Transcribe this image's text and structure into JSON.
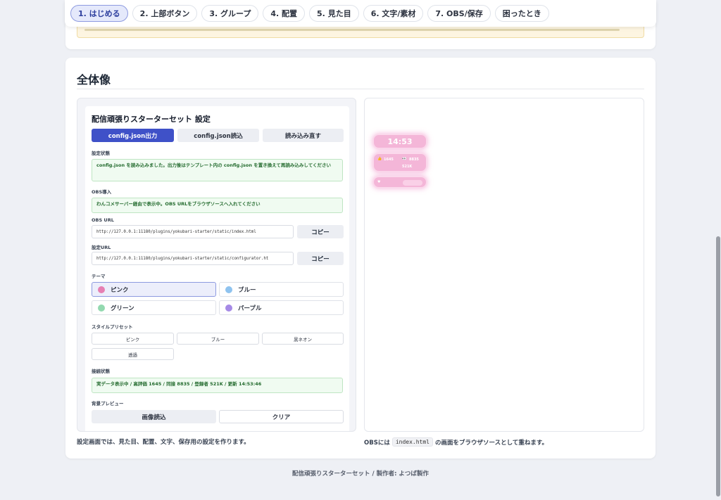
{
  "nav": {
    "items": [
      {
        "label": "1. はじめる",
        "active": true
      },
      {
        "label": "2. 上部ボタン",
        "active": false
      },
      {
        "label": "3. グループ",
        "active": false
      },
      {
        "label": "4. 配置",
        "active": false
      },
      {
        "label": "5. 見た目",
        "active": false
      },
      {
        "label": "6. 文字/素材",
        "active": false
      },
      {
        "label": "7. OBS/保存",
        "active": false
      },
      {
        "label": "困ったとき",
        "active": false
      }
    ]
  },
  "overview": {
    "title": "全体像",
    "left_caption": "設定画面では、見た目、配置、文字、保存用の設定を作ります。",
    "right_caption_prefix": "OBSには",
    "right_caption_code": "index.html",
    "right_caption_suffix": "の画面をブラウザソースとして重ねます。"
  },
  "configurator": {
    "title": "配信頑張りスターターセット 設定",
    "buttons": {
      "export": "config.json出力",
      "import": "config.json読込",
      "reload": "読み込み直す"
    },
    "status_label": "設定状態",
    "status_text": "config.json を読み込みました。出力後はテンプレート内の config.json を置き換えて再読み込みしてください",
    "obs_label": "OBS導入",
    "obs_text": "わんコメサーバー経由で表示中。OBS URLをブラウザソースへ入れてください",
    "obs_url_label": "OBS URL",
    "obs_url": "http://127.0.0.1:11180/plugins/yokubari-starter/static/index.html",
    "config_url_label": "設定URL",
    "config_url": "http://127.0.0.1:11180/plugins/yokubari-starter/static/configurator.ht",
    "copy_label": "コピー",
    "theme_label": "テーマ",
    "themes": [
      {
        "label": "ピンク",
        "color": "#e67fb3",
        "selected": true
      },
      {
        "label": "ブルー",
        "color": "#8fc3ef",
        "selected": false
      },
      {
        "label": "グリーン",
        "color": "#93d9b0",
        "selected": false
      },
      {
        "label": "パープル",
        "color": "#a68ae6",
        "selected": false
      }
    ],
    "preset_label": "スタイルプリセット",
    "presets": [
      "ピンク",
      "ブルー",
      "黒ネオン",
      "透過"
    ],
    "connection_label": "接続状態",
    "connection_text": "実データ表示中 / 高評価 1645 / 同接 8835 / 登録者 521K / 更新 14:53:46",
    "bg_label": "背景プレビュー",
    "bg_load": "画像読込",
    "bg_clear": "クリア"
  },
  "obs_preview": {
    "clock": "14:53",
    "likes": "1645",
    "viewers": "8835",
    "subs": "521K"
  },
  "footer": "配信頑張りスターターセット / 製作者: よつば製作",
  "colors": {
    "accent": "#3f51c8",
    "pink": "#f4b6d8",
    "success_bg": "#f0fbf1",
    "warning_bg": "#fdf5e1"
  }
}
